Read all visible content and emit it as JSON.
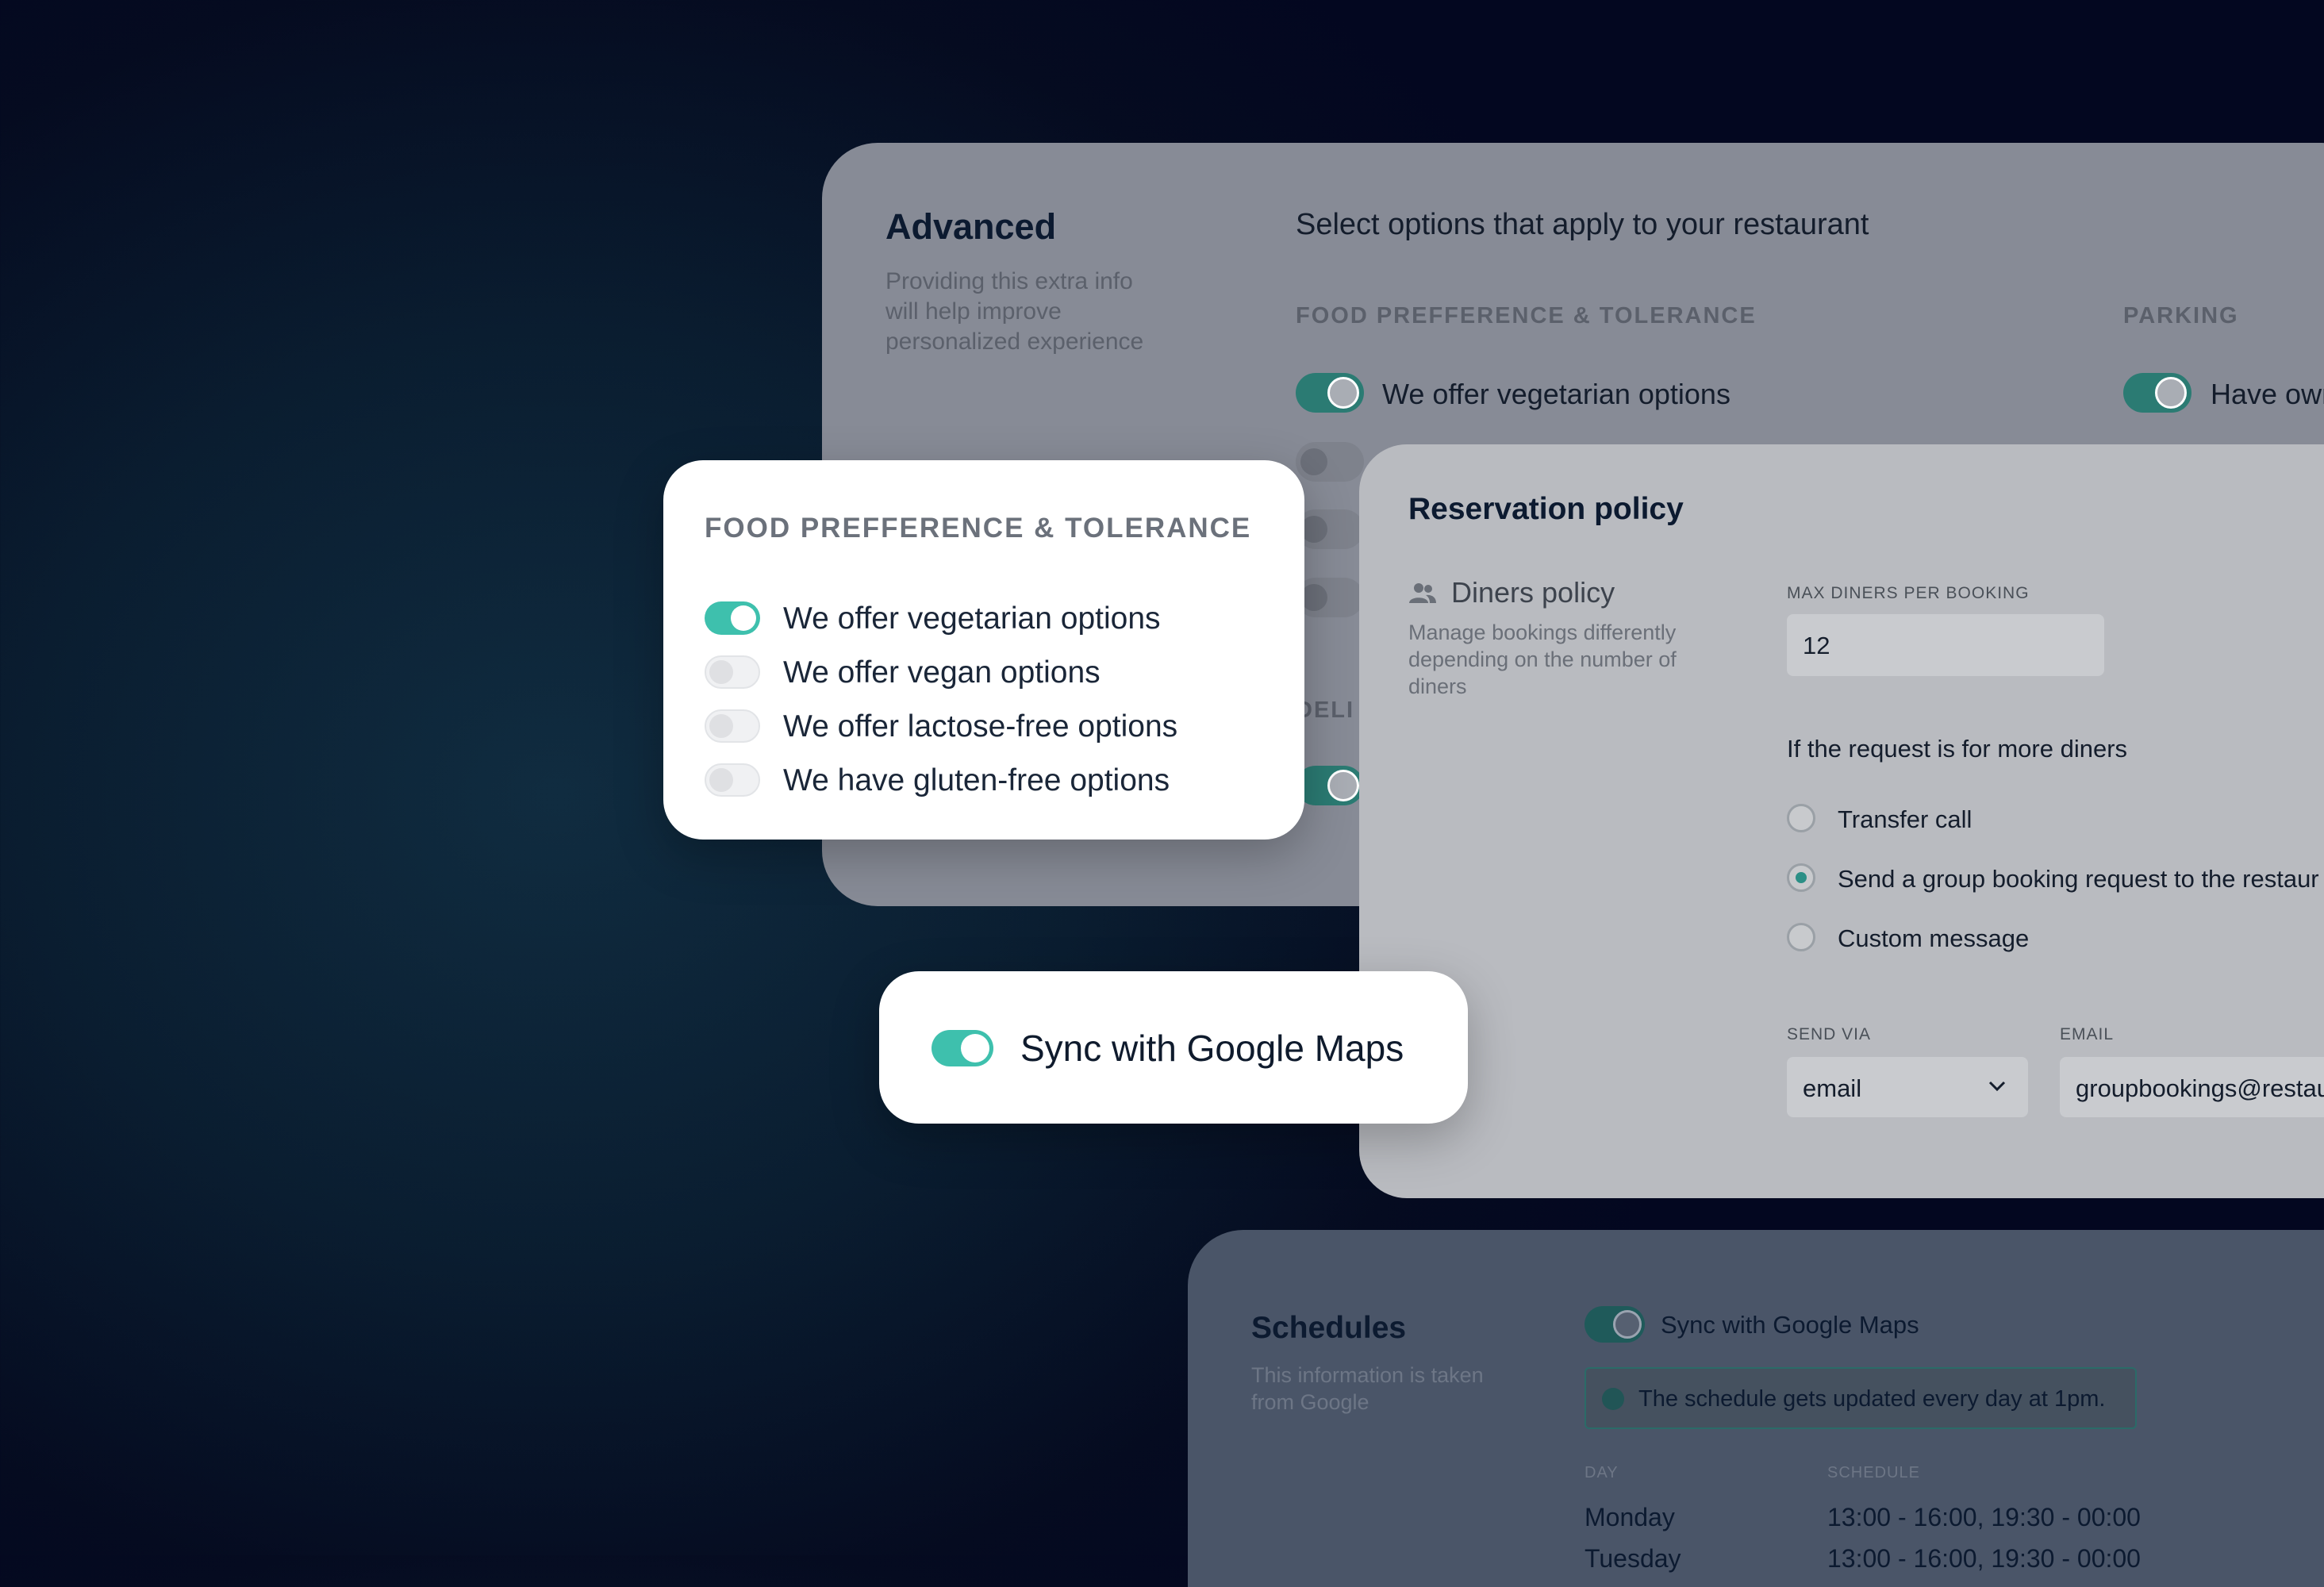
{
  "advanced": {
    "title": "Advanced",
    "description_lines": [
      "Providing this extra info",
      "will help improve",
      "personalized experience"
    ],
    "heading": "Select options that apply to your restaurant",
    "food_section": "FOOD PREFFERENCE & TOLERANCE",
    "parking_section": "PARKING",
    "vegetarian_label": "We offer vegetarian options",
    "parking_label": "Have own",
    "delivery_partial": "DELI"
  },
  "food_popup": {
    "title": "FOOD PREFFERENCE & TOLERANCE",
    "options": [
      {
        "label": "We offer vegetarian options",
        "on": true
      },
      {
        "label": "We offer vegan options",
        "on": false
      },
      {
        "label": "We offer lactose-free options",
        "on": false
      },
      {
        "label": "We have gluten-free options",
        "on": false
      }
    ]
  },
  "reservation": {
    "title": "Reservation policy",
    "diners_title": "Diners policy",
    "diners_desc_lines": [
      "Manage bookings differently",
      "depending on the number of",
      "diners"
    ],
    "max_label": "MAX DINERS PER BOOKING",
    "max_value": "12",
    "more_label": "If the request is for more diners",
    "options": [
      {
        "label": "Transfer call",
        "selected": false
      },
      {
        "label": "Send a group booking request to the restaur",
        "selected": true
      },
      {
        "label": "Custom message",
        "selected": false
      }
    ],
    "send_via_label": "SEND VIA",
    "send_via_value": "email",
    "email_label": "EMAIL",
    "email_value": "groupbookings@restau"
  },
  "sync_popup": {
    "label": "Sync with Google Maps",
    "on": true
  },
  "schedules": {
    "title": "Schedules",
    "desc_lines": [
      "This information is taken",
      "from Google"
    ],
    "sync_label": "Sync with Google Maps",
    "info": "The schedule gets updated every day at 1pm.",
    "day_header": "DAY",
    "schedule_header": "SCHEDULE",
    "rows": [
      {
        "day": "Monday",
        "hours": "13:00 - 16:00, 19:30 - 00:00"
      },
      {
        "day": "Tuesday",
        "hours": "13:00 - 16:00, 19:30 - 00:00"
      }
    ]
  },
  "colors": {
    "accent": "#3ec0ad",
    "dark_accent": "#2b8f86",
    "background": "#050b20"
  }
}
